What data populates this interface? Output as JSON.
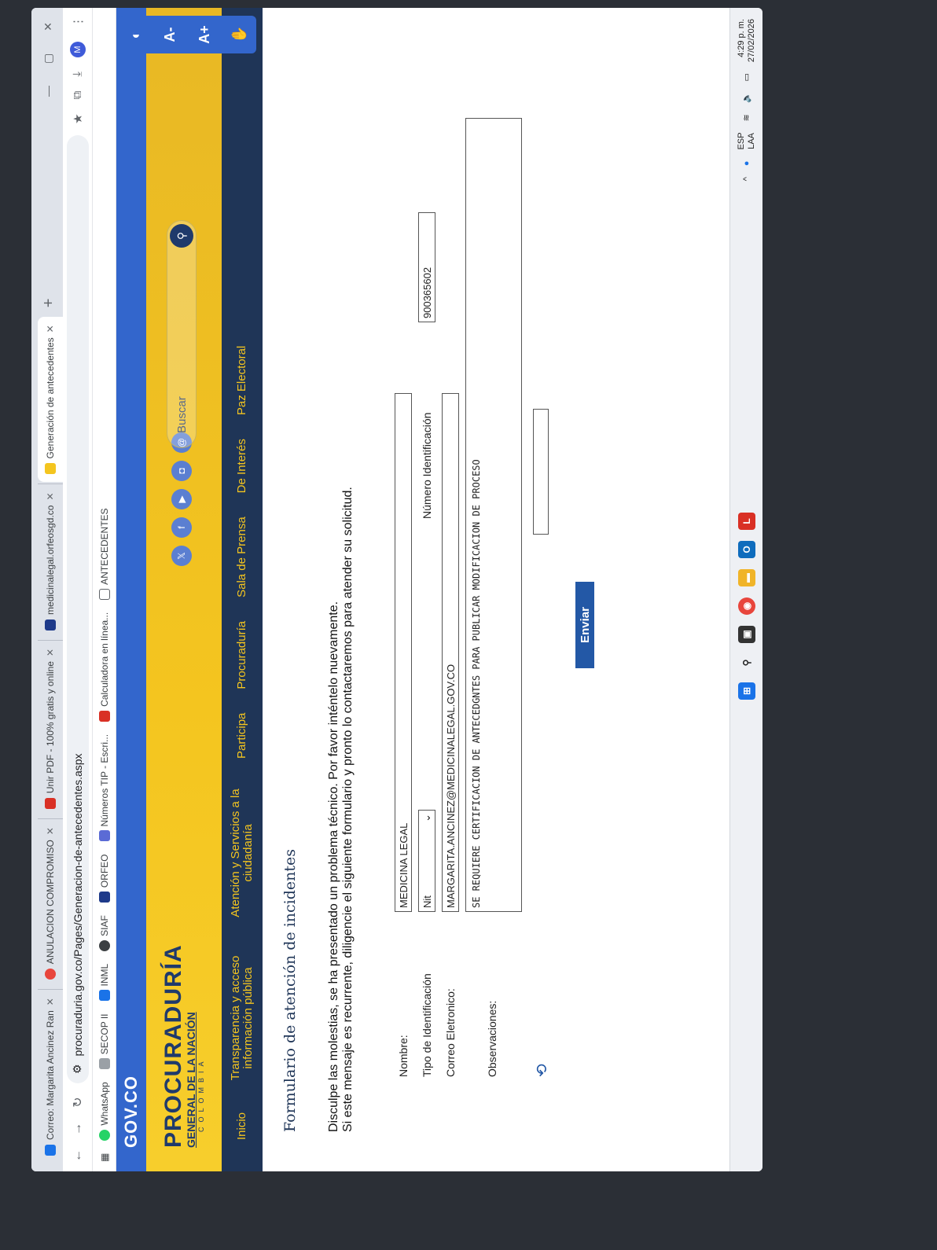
{
  "browser": {
    "tabs": [
      {
        "label": "Correo: Margarita Ancinez Ran",
        "color": "#1a73e8",
        "active": false
      },
      {
        "label": "ANULACION COMPROMISO",
        "color": "#e8453c",
        "active": false
      },
      {
        "label": "Unir PDF - 100% gratis y online",
        "color": "#d93025",
        "active": false
      },
      {
        "label": "medicinalegal.orfeosgd.co",
        "color": "#1e3a8a",
        "active": false
      },
      {
        "label": "Generación de antecedentes",
        "color": "#f4c51f",
        "active": true
      }
    ],
    "new_tab": "+",
    "url": "procuraduria.gov.co/Pages/Generacion-de-antecedentes.aspx",
    "profile_initial": "M",
    "bookmarks": [
      {
        "label": "WhatsApp",
        "color": "#25d366"
      },
      {
        "label": "SECOP II",
        "color": "#9aa0a6"
      },
      {
        "label": "INML",
        "color": "#1a73e8"
      },
      {
        "label": "SIAF",
        "color": "#3c4043"
      },
      {
        "label": "ORFEO",
        "color": "#1e3a8a"
      },
      {
        "label": "Números TIP - Escri...",
        "color": "#5b6bd5"
      },
      {
        "label": "Calculadora en línea...",
        "color": "#d93025"
      },
      {
        "label": "ANTECEDENTES",
        "color": "#9aa0a6"
      }
    ]
  },
  "site": {
    "gov_logo": "GOV.CO",
    "brand_line1": "PROCURADURÍA",
    "brand_line2": "GENERAL DE LA NACIÓN",
    "brand_line3": "COLOMBIA",
    "search_placeholder": "Buscar",
    "nav": [
      "Inicio",
      "Transparencia y acceso información pública",
      "Atención y Servicios a la ciudadanía",
      "Participa",
      "Procuraduría",
      "Sala de Prensa",
      "De Interés",
      "Paz Electoral"
    ],
    "a11y": [
      "◐",
      "A-",
      "A+",
      "✋"
    ]
  },
  "form": {
    "title": "Formulario de atención de incidentes",
    "message_line1": "Disculpe las molestias, se ha presentado un problema técnico. Por favor inténtelo nuevamente.",
    "message_line2": "Si este mensaje es recurrente, diligencie el siguiente formulario y pronto lo contactaremos para atender su solicitud.",
    "nombre_label": "Nombre:",
    "nombre_value": "MEDICINA LEGAL",
    "tipo_label": "Tipo de Identificación",
    "tipo_value": "Nit",
    "numero_label": "Número Identificación",
    "numero_value": "900365602",
    "correo_label": "Correo Eletronico:",
    "correo_value": "MARGARITA.ANCINEZ@MEDICINALEGAL.GOV.CO",
    "obs_label": "Observaciones:",
    "obs_value": "SE REQUIERE CERTIFICACION DE ANTECEDGNTES PARA PUBLICAR MODIFICACION DE PROCESO",
    "submit_label": "Enviar"
  },
  "taskbar": {
    "lang_top": "ESP",
    "lang_bottom": "LAA",
    "time": "4:29 p. m.",
    "date": "27/02/2026"
  }
}
